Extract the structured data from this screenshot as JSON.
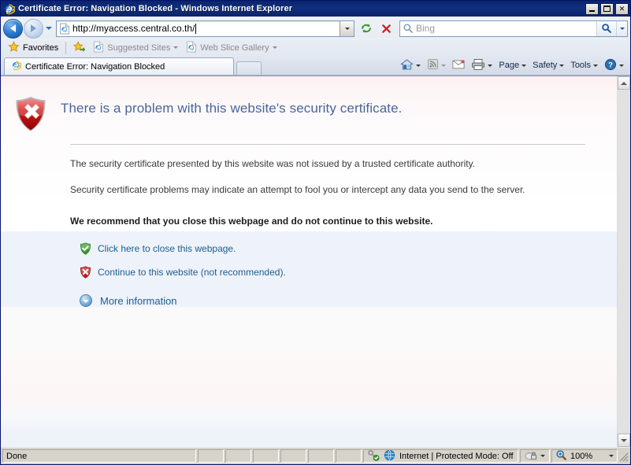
{
  "window": {
    "title": "Certificate Error: Navigation Blocked - Windows Internet Explorer",
    "app_icon": "ie-logo-icon",
    "minimize_label": "Minimize",
    "maximize_label": "Maximize",
    "close_label": "Close",
    "close_glyph": "✕"
  },
  "navigation": {
    "back_label": "Back",
    "forward_label": "Forward",
    "recent_pages_label": "Recent Pages",
    "address": {
      "value": "http://myaccess.central.co.th/",
      "icon": "page-icon",
      "dropdown_label": "Address history"
    },
    "refresh_label": "Refresh",
    "stop_label": "Stop",
    "search": {
      "placeholder": "Bing",
      "icon": "magnifier-icon",
      "go_label": "Search",
      "provider_dropdown_label": "Search provider"
    }
  },
  "favorites_bar": {
    "favorites_label": "Favorites",
    "favorites_icon": "star-icon",
    "add_favorite_icon": "add-star-icon",
    "items": [
      {
        "label": "Suggested Sites",
        "icon": "ie-page-icon",
        "has_dropdown": true
      },
      {
        "label": "Web Slice Gallery",
        "icon": "ie-page-icon",
        "has_dropdown": true
      }
    ]
  },
  "tabs": {
    "active": {
      "label": "Certificate Error: Navigation Blocked",
      "icon": "ie-logo-icon"
    },
    "new_tab_label": "New Tab"
  },
  "command_bar": {
    "items": [
      {
        "label": "",
        "icon": "home-icon",
        "has_dropdown": true
      },
      {
        "label": "",
        "icon": "rss-feed-icon",
        "has_dropdown": true
      },
      {
        "label": "",
        "icon": "mail-icon",
        "has_dropdown": false
      },
      {
        "label": "",
        "icon": "print-icon",
        "has_dropdown": true
      },
      {
        "label": "Page",
        "icon": "",
        "has_dropdown": true
      },
      {
        "label": "Safety",
        "icon": "",
        "has_dropdown": true
      },
      {
        "label": "Tools",
        "icon": "",
        "has_dropdown": true
      },
      {
        "label": "",
        "icon": "help-icon",
        "has_dropdown": true
      }
    ]
  },
  "page": {
    "heading": "There is a problem with this website's security certificate.",
    "heading_icon": "red-shield-error-icon",
    "paragraph_1": "The security certificate presented by this website was not issued by a trusted certificate authority.",
    "paragraph_2": "Security certificate problems may indicate an attempt to fool you or intercept any data you send to the server.",
    "recommendation": "We recommend that you close this webpage and do not continue to this website.",
    "links": [
      {
        "label": "Click here to close this webpage.",
        "icon": "green-shield-ok-icon"
      },
      {
        "label": "Continue to this website (not recommended).",
        "icon": "red-shield-warning-icon"
      }
    ],
    "more_information": {
      "label": "More information",
      "icon": "chevron-down-circle-icon"
    }
  },
  "scrollbar": {
    "up_label": "Scroll up",
    "down_label": "Scroll down"
  },
  "status_bar": {
    "message": "Done",
    "security_icon": "key-check-icon",
    "zone_icon": "globe-icon",
    "zone_text": "Internet | Protected Mode: Off",
    "privacy_icon": "privacy-lock-icon",
    "zoom_icon": "zoom-magnifier-icon",
    "zoom_level": "100%"
  },
  "colors": {
    "titlebar": "#0a246a",
    "heading": "#4a669b",
    "link": "#1a5f8f",
    "error_red": "#c62027",
    "ok_green": "#3a9c2e"
  }
}
